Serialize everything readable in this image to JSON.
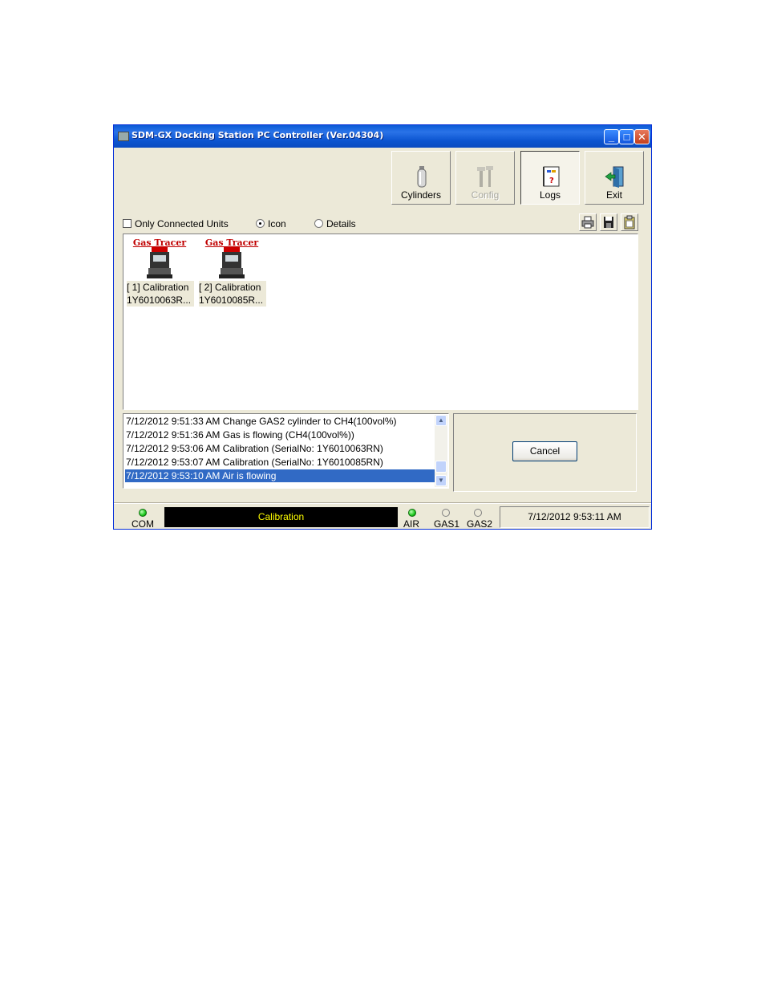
{
  "window": {
    "title": "SDM-GX Docking Station PC Controller (Ver.04304)",
    "controls": {
      "minimize": "_",
      "maximize": "□",
      "close": "✕"
    }
  },
  "toolbar": {
    "cylinders_label": "Cylinders",
    "config_label": "Config",
    "logs_label": "Logs",
    "exit_label": "Exit"
  },
  "view_options": {
    "only_connected_label": "Only Connected Units",
    "only_connected_checked": false,
    "icon_label": "Icon",
    "details_label": "Details",
    "selected_view": "Icon"
  },
  "units": [
    {
      "brand": "Gas Tracer",
      "status": "[ 1] Calibration",
      "serial": "1Y6010063R..."
    },
    {
      "brand": "Gas Tracer",
      "status": "[ 2] Calibration",
      "serial": "1Y6010085R..."
    }
  ],
  "log_entries": [
    "7/12/2012 9:51:33 AM Change GAS2 cylinder to CH4(100vol%)",
    "7/12/2012 9:51:36 AM Gas is flowing (CH4(100vol%))",
    "7/12/2012 9:53:06 AM Calibration (SerialNo: 1Y6010063RN)",
    "7/12/2012 9:53:07 AM Calibration (SerialNo: 1Y6010085RN)",
    "7/12/2012 9:53:10 AM Air is flowing"
  ],
  "selected_log_index": 4,
  "cancel_label": "Cancel",
  "status_bar": {
    "com_label": "COM",
    "com_on": true,
    "message": "Calibration",
    "air_label": "AIR",
    "air_on": true,
    "gas1_label": "GAS1",
    "gas1_on": false,
    "gas2_label": "GAS2",
    "gas2_on": false,
    "datetime": "7/12/2012 9:53:11 AM"
  },
  "colors": {
    "message_text": "#ffff00",
    "selection": "#316ac5",
    "led_on": "#1ec81e",
    "brand_red": "#c00000"
  }
}
